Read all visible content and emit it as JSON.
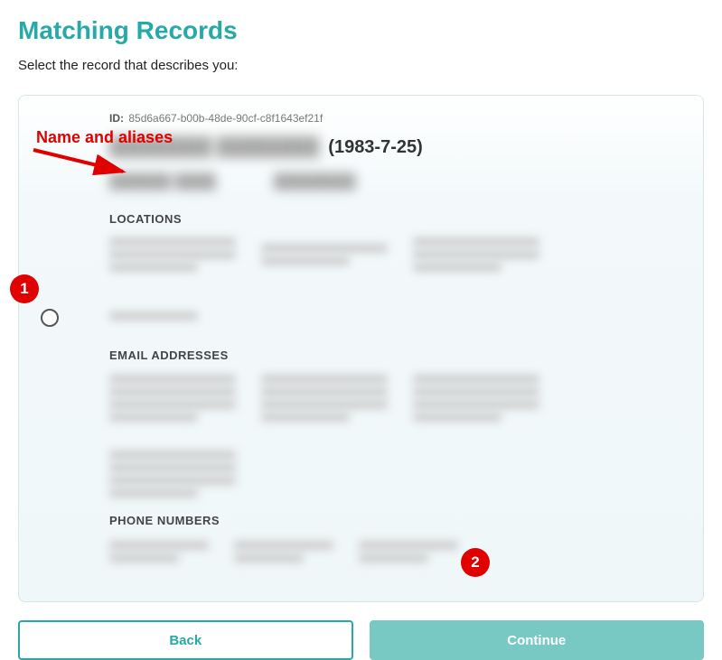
{
  "page": {
    "title": "Matching Records",
    "instruction": "Select the record that describes you:"
  },
  "record": {
    "id_label": "ID:",
    "id_value": "85d6a667-b00b-48de-90cf-c8f1643ef21f",
    "dob": "(1983-7-25)",
    "sections": {
      "locations_label": "LOCATIONS",
      "emails_label": "EMAIL ADDRESSES",
      "phones_label": "PHONE NUMBERS"
    }
  },
  "buttons": {
    "back": "Back",
    "continue": "Continue"
  },
  "annotations": {
    "name_aliases_label": "Name and aliases",
    "badge1": "1",
    "badge2": "2"
  }
}
